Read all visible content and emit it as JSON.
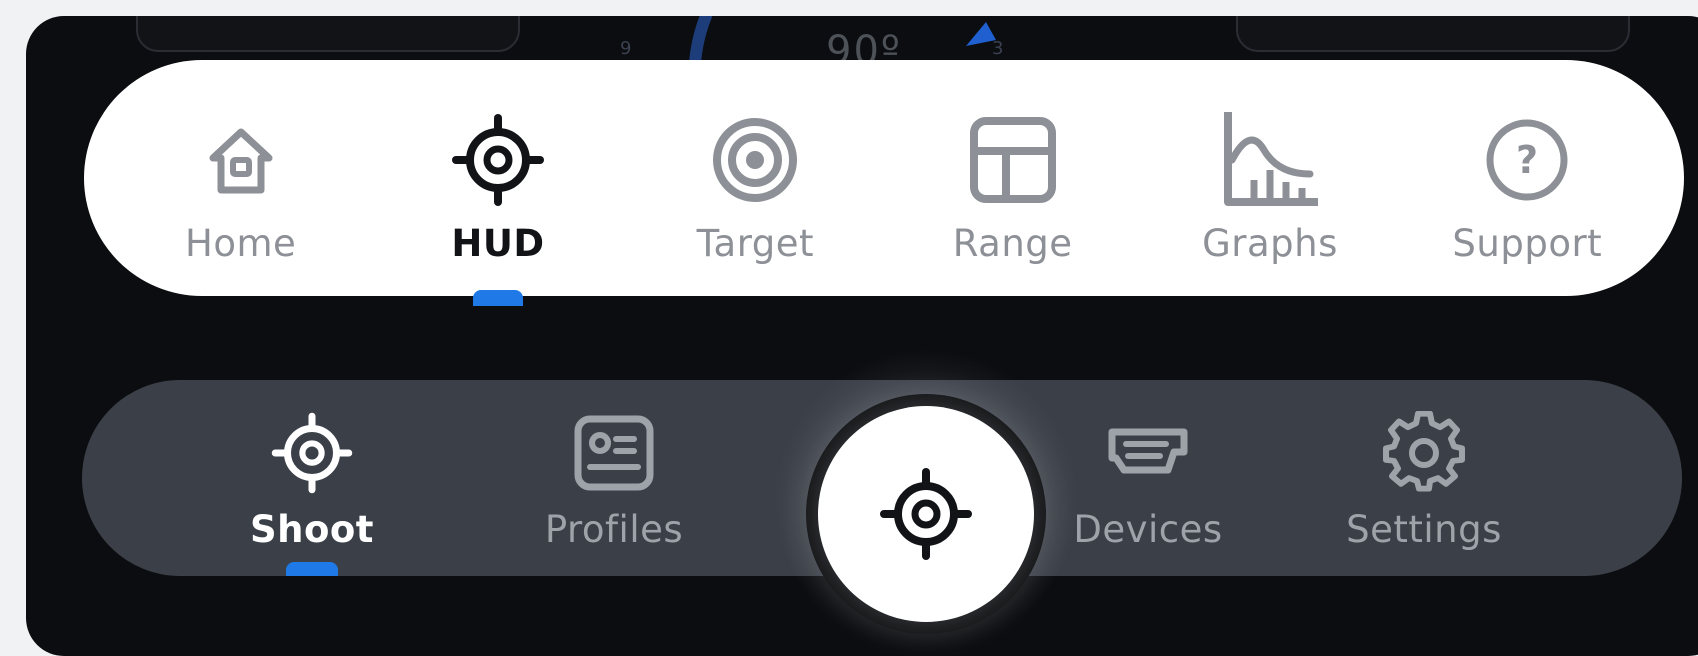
{
  "background": {
    "angle_readout": "90º",
    "tick_left": "9",
    "tick_right": "3"
  },
  "top_nav": {
    "items": [
      {
        "label": "Home",
        "icon": "home-icon",
        "active": false
      },
      {
        "label": "HUD",
        "icon": "crosshair-icon",
        "active": true
      },
      {
        "label": "Target",
        "icon": "target-icon",
        "active": false
      },
      {
        "label": "Range",
        "icon": "grid-table-icon",
        "active": false
      },
      {
        "label": "Graphs",
        "icon": "graph-chart-icon",
        "active": false
      },
      {
        "label": "Support",
        "icon": "help-circle-icon",
        "active": false
      }
    ]
  },
  "bottom_nav": {
    "items": [
      {
        "label": "Shoot",
        "icon": "crosshair-icon",
        "active": true
      },
      {
        "label": "Profiles",
        "icon": "profile-card-icon",
        "active": false
      },
      {
        "label": "Devices",
        "icon": "device-icon",
        "active": false
      },
      {
        "label": "Settings",
        "icon": "gear-icon",
        "active": false
      }
    ],
    "center_button_icon": "crosshair-icon"
  },
  "colors": {
    "accent": "#1f7ae8",
    "top_nav_bg": "#ffffff",
    "bottom_nav_bg": "#3b4048",
    "screen_bg": "#0c0d10"
  }
}
